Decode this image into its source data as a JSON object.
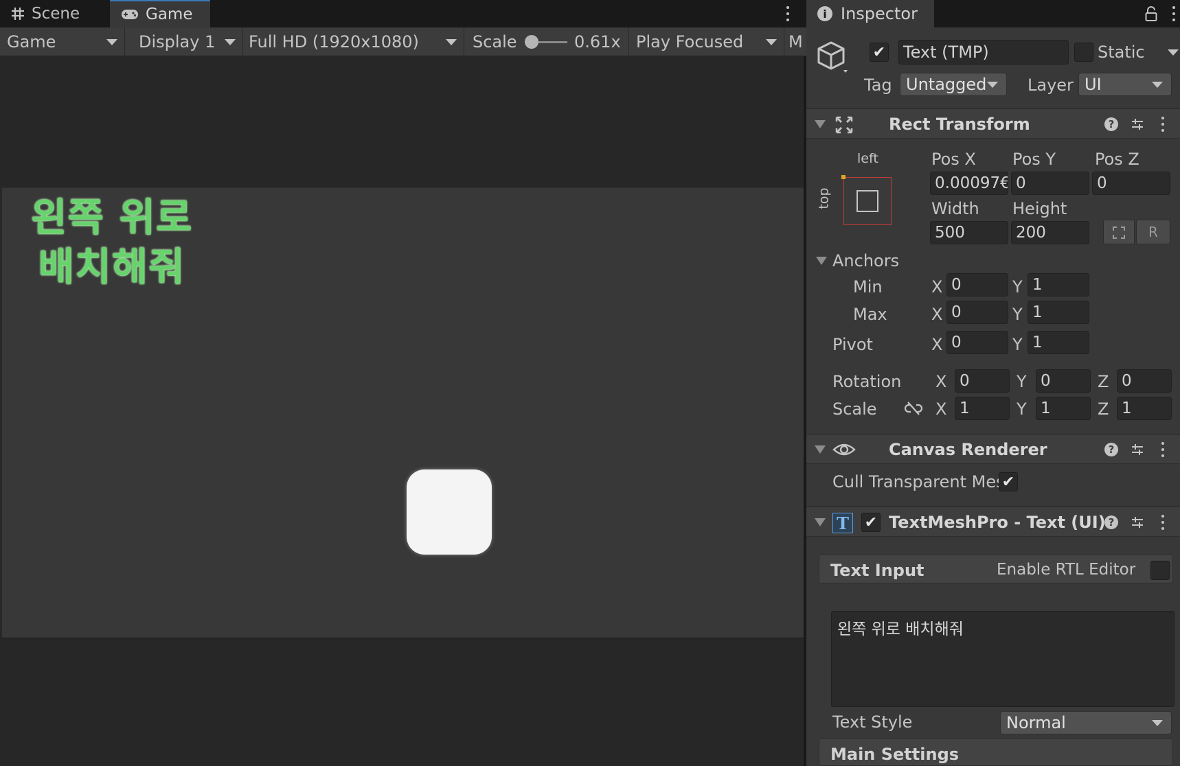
{
  "game_view": {
    "tabs": [
      {
        "label": "Scene",
        "icon": "grid-icon"
      },
      {
        "label": "Game",
        "icon": "gamepad-icon"
      }
    ],
    "toolbar": {
      "view_mode": "Game",
      "display": "Display 1",
      "resolution": "Full HD (1920x1080)",
      "scale_label": "Scale",
      "scale_value": "0.61x",
      "play_mode": "Play Focused",
      "more": "M"
    },
    "scene_text": {
      "line1": "왼쪽 위로",
      "line2": "배치해줘",
      "color": "#67d36c"
    },
    "button_color": "#f4f4f4"
  },
  "inspector": {
    "tab_label": "Inspector",
    "object": {
      "name": "Text (TMP)",
      "active": true,
      "static_label": "Static",
      "static_checked": false,
      "tag_label": "Tag",
      "tag_value": "Untagged",
      "layer_label": "Layer",
      "layer_value": "UI"
    },
    "rect_transform": {
      "title": "Rect Transform",
      "anchor_preset": {
        "horizontal": "left",
        "vertical": "top"
      },
      "pos_x_label": "Pos X",
      "pos_y_label": "Pos Y",
      "pos_z_label": "Pos Z",
      "pos_x": "0.00097€",
      "pos_y": "0",
      "pos_z": "0",
      "width_label": "Width",
      "height_label": "Height",
      "width": "500",
      "height": "200",
      "raw_button": "R",
      "anchors_label": "Anchors",
      "min_label": "Min",
      "max_label": "Max",
      "pivot_label": "Pivot",
      "x_label": "X",
      "y_label": "Y",
      "z_label": "Z",
      "anchor_min": {
        "x": "0",
        "y": "1"
      },
      "anchor_max": {
        "x": "0",
        "y": "1"
      },
      "pivot": {
        "x": "0",
        "y": "1"
      },
      "rotation_label": "Rotation",
      "rotation": {
        "x": "0",
        "y": "0",
        "z": "0"
      },
      "scale_label": "Scale",
      "scale": {
        "x": "1",
        "y": "1",
        "z": "1"
      }
    },
    "canvas_renderer": {
      "title": "Canvas Renderer",
      "cull_label": "Cull Transparent Mes",
      "cull_checked": true
    },
    "tmp_text": {
      "title": "TextMeshPro - Text (UI)",
      "enabled": true,
      "text_input_label": "Text Input",
      "rtl_label": "Enable RTL Editor",
      "rtl_checked": false,
      "text_value": "왼쪽 위로 배치해줘",
      "text_style_label": "Text Style",
      "text_style_value": "Normal",
      "main_settings_label": "Main Settings"
    }
  },
  "colors": {
    "accent": "#3a79bb",
    "panel": "#383838",
    "field": "#2a2a2a"
  }
}
